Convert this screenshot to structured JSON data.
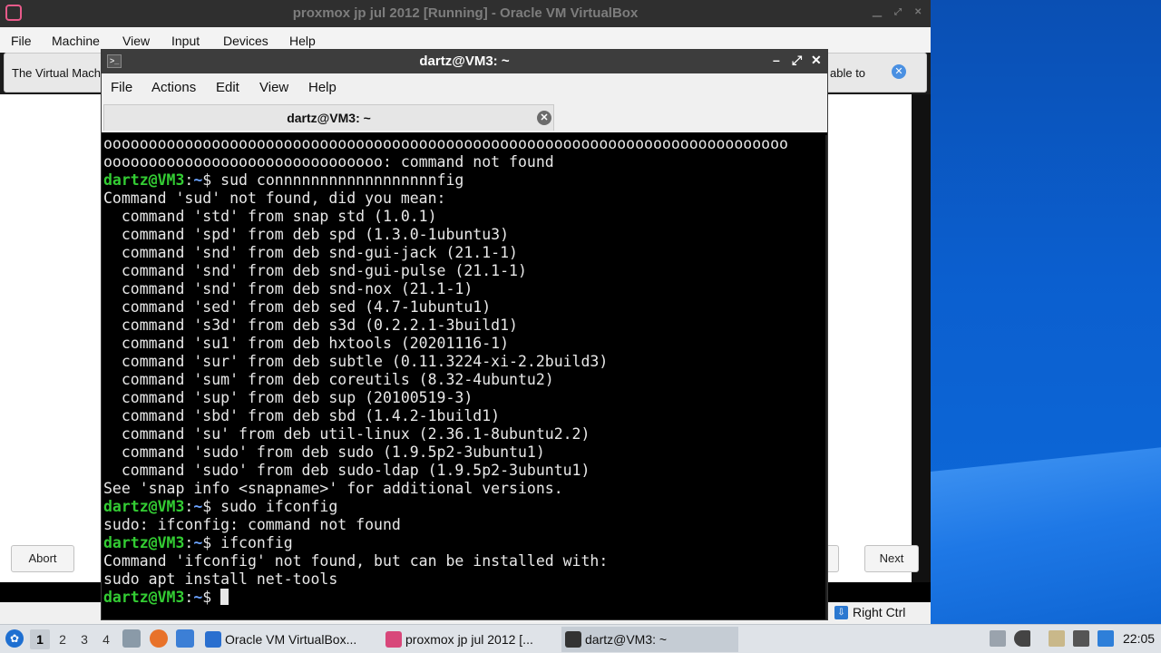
{
  "vbox": {
    "title": "proxmox jp jul 2012 [Running] - Oracle VM VirtualBox",
    "menu": [
      "File",
      "Machine",
      "View",
      "Input",
      "Devices",
      "Help"
    ],
    "notify_left": "The Virtual Mach",
    "notify_right": "able to",
    "notify_close": "✕",
    "host_key": "Right Ctrl",
    "window_buttons": [
      "⎽",
      "⤢",
      "✕"
    ]
  },
  "installer": {
    "abort_label": "Abort",
    "next_label": "Next"
  },
  "terminal": {
    "title": "dartz@VM3: ~",
    "menu": [
      "File",
      "Actions",
      "Edit",
      "View",
      "Help"
    ],
    "tab_label": "dartz@VM3: ~",
    "tab_close": "✕",
    "icon_glyph": ">_",
    "window_buttons": [
      "–",
      "⤢",
      "✕"
    ],
    "prompt": {
      "user": "dartz@VM3",
      "sep": ":",
      "path": "~",
      "sym": "$"
    },
    "lines": [
      {
        "t": "text",
        "v": "oooooooooooooooooooooooooooooooooooooooooooooooooooooooooooooooooooooooooooo"
      },
      {
        "t": "text",
        "v": "ooooooooooooooooooooooooooooooo: command not found"
      },
      {
        "t": "prompt",
        "v": " sud connnnnnnnnnnnnnnnnnfig"
      },
      {
        "t": "text",
        "v": "Command 'sud' not found, did you mean:"
      },
      {
        "t": "text",
        "v": "  command 'std' from snap std (1.0.1)"
      },
      {
        "t": "text",
        "v": "  command 'spd' from deb spd (1.3.0-1ubuntu3)"
      },
      {
        "t": "text",
        "v": "  command 'snd' from deb snd-gui-jack (21.1-1)"
      },
      {
        "t": "text",
        "v": "  command 'snd' from deb snd-gui-pulse (21.1-1)"
      },
      {
        "t": "text",
        "v": "  command 'snd' from deb snd-nox (21.1-1)"
      },
      {
        "t": "text",
        "v": "  command 'sed' from deb sed (4.7-1ubuntu1)"
      },
      {
        "t": "text",
        "v": "  command 's3d' from deb s3d (0.2.2.1-3build1)"
      },
      {
        "t": "text",
        "v": "  command 'su1' from deb hxtools (20201116-1)"
      },
      {
        "t": "text",
        "v": "  command 'sur' from deb subtle (0.11.3224-xi-2.2build3)"
      },
      {
        "t": "text",
        "v": "  command 'sum' from deb coreutils (8.32-4ubuntu2)"
      },
      {
        "t": "text",
        "v": "  command 'sup' from deb sup (20100519-3)"
      },
      {
        "t": "text",
        "v": "  command 'sbd' from deb sbd (1.4.2-1build1)"
      },
      {
        "t": "text",
        "v": "  command 'su' from deb util-linux (2.36.1-8ubuntu2.2)"
      },
      {
        "t": "text",
        "v": "  command 'sudo' from deb sudo (1.9.5p2-3ubuntu1)"
      },
      {
        "t": "text",
        "v": "  command 'sudo' from deb sudo-ldap (1.9.5p2-3ubuntu1)"
      },
      {
        "t": "text",
        "v": "See 'snap info <snapname>' for additional versions."
      },
      {
        "t": "prompt",
        "v": " sudo ifconfig"
      },
      {
        "t": "text",
        "v": "sudo: ifconfig: command not found"
      },
      {
        "t": "prompt",
        "v": " ifconfig"
      },
      {
        "t": "text",
        "v": "Command 'ifconfig' not found, but can be installed with:"
      },
      {
        "t": "text",
        "v": "sudo apt install net-tools"
      },
      {
        "t": "prompt",
        "v": " ",
        "cursor": true
      }
    ]
  },
  "taskbar": {
    "workspaces": [
      "1",
      "2",
      "3",
      "4"
    ],
    "tasks": [
      {
        "label": "Oracle VM VirtualBox...",
        "icon_color": "#2a6fcf",
        "icon": "virtualbox-icon"
      },
      {
        "label": "proxmox jp jul 2012 [...",
        "icon_color": "#d8477a",
        "icon": "vm-icon"
      },
      {
        "label": "dartz@VM3: ~",
        "icon_color": "#333333",
        "icon": "terminal-icon"
      }
    ],
    "clock": "22:05"
  }
}
